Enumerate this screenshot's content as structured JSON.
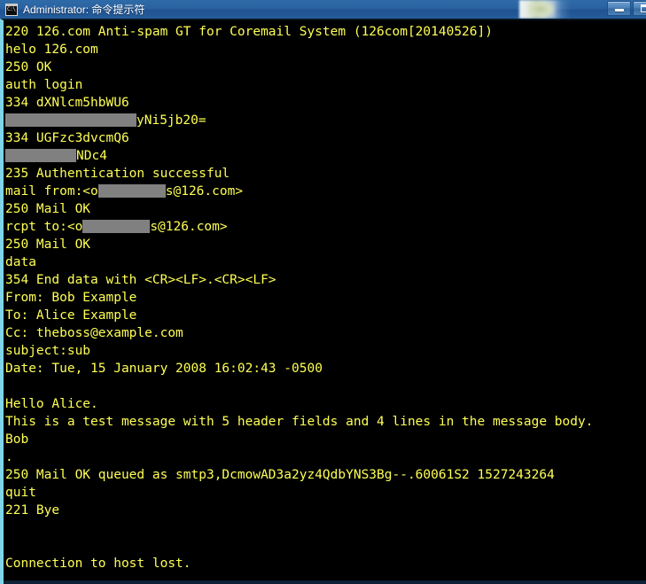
{
  "window": {
    "title": "Administrator: 命令提示符",
    "app_icon": "console-icon",
    "buttons": [
      {
        "name": "minimize-button",
        "glyph": "minimize-icon"
      },
      {
        "name": "maximize-button",
        "glyph": "maximize-icon"
      }
    ]
  },
  "colors": {
    "terminal_background": "#000000",
    "terminal_foreground": "#ffff55",
    "titlebar": "#255d9b",
    "redaction": "#808080",
    "left_border": "#7fd4ea"
  },
  "terminal": {
    "lines": [
      {
        "text": "220 126.com Anti-spam GT for Coremail System (126com[20140526])"
      },
      {
        "text": "helo 126.com"
      },
      {
        "text": "250 OK"
      },
      {
        "text": "auth login"
      },
      {
        "text": "334 dXNlcm5hbWU6"
      },
      {
        "pre": "",
        "redact_width": 148,
        "post": "yNi5jb20="
      },
      {
        "text": "334 UGFzc3dvcmQ6"
      },
      {
        "pre": "",
        "redact_width": 80,
        "post": "NDc4"
      },
      {
        "text": "235 Authentication successful"
      },
      {
        "pre": "mail from:<o",
        "redact_width": 76,
        "post": "s@126.com>"
      },
      {
        "text": "250 Mail OK"
      },
      {
        "pre": "rcpt to:<o",
        "redact_width": 76,
        "post": "s@126.com>"
      },
      {
        "text": "250 Mail OK"
      },
      {
        "text": "data"
      },
      {
        "text": "354 End data with <CR><LF>.<CR><LF>"
      },
      {
        "text": "From: Bob Example"
      },
      {
        "text": "To: Alice Example"
      },
      {
        "text": "Cc: theboss@example.com"
      },
      {
        "text": "subject:sub"
      },
      {
        "text": "Date: Tue, 15 January 2008 16:02:43 -0500"
      },
      {
        "text": ""
      },
      {
        "text": "Hello Alice."
      },
      {
        "text": "This is a test message with 5 header fields and 4 lines in the message body."
      },
      {
        "text": "Bob"
      },
      {
        "text": "."
      },
      {
        "text": "250 Mail OK queued as smtp3,DcmowAD3a2yz4QdbYNS3Bg--.60061S2 1527243264"
      },
      {
        "text": "quit"
      },
      {
        "text": "221 Bye"
      },
      {
        "text": ""
      },
      {
        "text": ""
      },
      {
        "text": "Connection to host lost."
      }
    ]
  }
}
